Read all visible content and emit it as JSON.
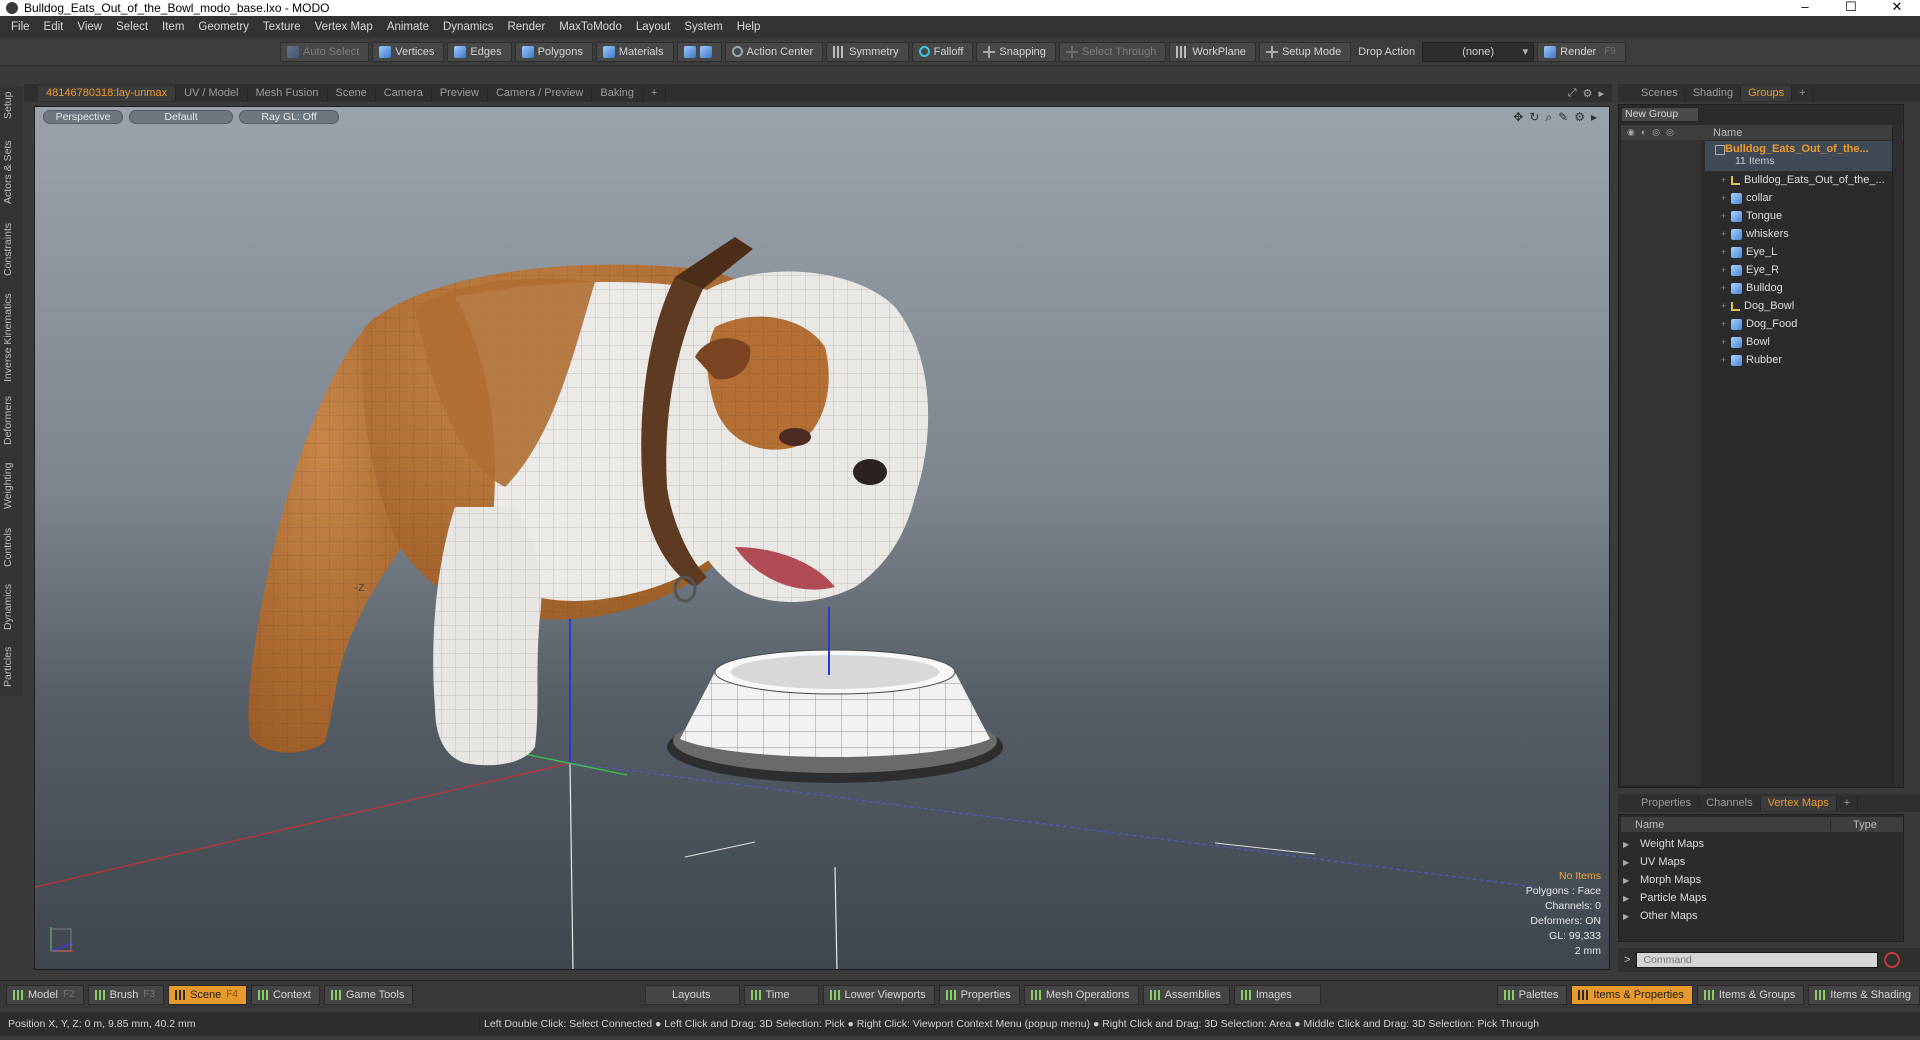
{
  "window": {
    "title": "Bulldog_Eats_Out_of_the_Bowl_modo_base.lxo - MODO",
    "controls": [
      "–",
      "☐",
      "✕"
    ]
  },
  "menu": [
    "File",
    "Edit",
    "View",
    "Select",
    "Item",
    "Geometry",
    "Texture",
    "Vertex Map",
    "Animate",
    "Dynamics",
    "Render",
    "MaxToModo",
    "Layout",
    "System",
    "Help"
  ],
  "toolbar": {
    "auto_select": "Auto Select",
    "vertices": "Vertices",
    "edges": "Edges",
    "polygons": "Polygons",
    "materials": "Materials",
    "action_center": "Action Center",
    "symmetry": "Symmetry",
    "falloff": "Falloff",
    "snapping": "Snapping",
    "select_through": "Select Through",
    "workplane": "WorkPlane",
    "setup_mode": "Setup Mode",
    "drop_action_label": "Drop Action",
    "drop_action_value": "(none)",
    "render": "Render",
    "render_key": "F9"
  },
  "left_tabs": [
    "Setup",
    "Actors & Sets",
    "Constraints",
    "Inverse Kinematics",
    "Deformers",
    "Weighting",
    "Controls",
    "Dynamics",
    "Particles"
  ],
  "viewport_tabs": [
    "48146780318:lay-unmax",
    "UV / Model",
    "Mesh Fusion",
    "Scene",
    "Camera",
    "Preview",
    "Camera / Preview",
    "Baking",
    "+"
  ],
  "viewport": {
    "view_mode": "Perspective",
    "shading": "Default",
    "raygl": "Ray GL: Off",
    "stats": {
      "items": "No Items",
      "polygons": "Polygons : Face",
      "channels": "Channels: 0",
      "deformers": "Deformers: ON",
      "gl": "GL: 99,333",
      "scale": "2 mm"
    },
    "axis_label": "-Z",
    "colors": {
      "accent": "#ee9a28",
      "x_axis": "#d03030",
      "y_axis": "#2e3edc",
      "z_axis": "#36b04a"
    }
  },
  "right_top_tabs": [
    "Scenes",
    "Shading",
    "Groups",
    "+"
  ],
  "groups": {
    "new_group": "New Group",
    "col_name": "Name",
    "root_name": "Bulldog_Eats_Out_of_the...",
    "root_count": "11 Items",
    "items": [
      {
        "label": "Bulldog_Eats_Out_of_the_...",
        "icon": "locator-icon"
      },
      {
        "label": "collar",
        "icon": "mesh-icon"
      },
      {
        "label": "Tongue",
        "icon": "mesh-icon"
      },
      {
        "label": "whiskers",
        "icon": "mesh-icon"
      },
      {
        "label": "Eye_L",
        "icon": "mesh-icon"
      },
      {
        "label": "Eye_R",
        "icon": "mesh-icon"
      },
      {
        "label": "Bulldog",
        "icon": "mesh-icon"
      },
      {
        "label": "Dog_Bowl",
        "icon": "locator-icon"
      },
      {
        "label": "Dog_Food",
        "icon": "mesh-icon"
      },
      {
        "label": "Bowl",
        "icon": "mesh-icon"
      },
      {
        "label": "Rubber",
        "icon": "mesh-icon"
      }
    ]
  },
  "right_bottom_tabs": [
    "Properties",
    "Channels",
    "Vertex Maps",
    "+"
  ],
  "vertex_maps": {
    "col_name": "Name",
    "col_type": "Type",
    "items": [
      "Weight Maps",
      "UV Maps",
      "Morph Maps",
      "Particle Maps",
      "Other Maps"
    ]
  },
  "command": {
    "placeholder": "Command",
    "prompt": ">"
  },
  "bottom_left": [
    {
      "label": "Model",
      "key": "F2"
    },
    {
      "label": "Brush",
      "key": "F3"
    },
    {
      "label": "Scene",
      "key": "F4"
    },
    {
      "label": "Context",
      "key": ""
    },
    {
      "label": "Game Tools",
      "key": ""
    }
  ],
  "bottom_center": [
    "Layouts",
    "Time",
    "Lower Viewports",
    "Properties",
    "Mesh Operations",
    "Assemblies",
    "Images"
  ],
  "bottom_right": [
    "Palettes",
    "Items & Properties",
    "Items & Groups",
    "Items & Shading"
  ],
  "status": {
    "position": "Position X, Y, Z:  0 m, 9.85 mm, 40.2 mm",
    "hint": "Left Double Click: Select Connected ● Left Click and Drag: 3D Selection: Pick ● Right Click: Viewport Context Menu (popup menu) ● Right Click and Drag: 3D Selection: Area ● Middle Click and Drag: 3D Selection: Pick Through"
  }
}
